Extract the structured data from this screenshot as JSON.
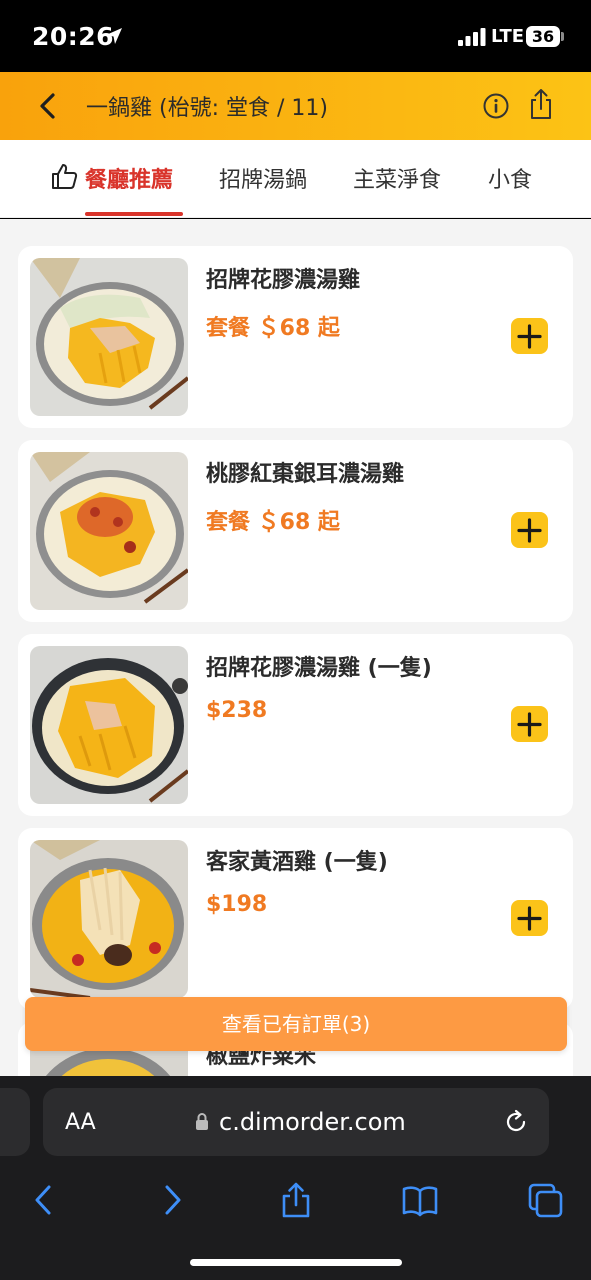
{
  "status_bar": {
    "time": "20:26",
    "network": "LTE",
    "battery": "36"
  },
  "header": {
    "title": "一鍋雞 (枱號: 堂食 / 11)"
  },
  "tabs": [
    {
      "label": "餐廳推薦",
      "active": true
    },
    {
      "label": "招牌湯鍋",
      "active": false
    },
    {
      "label": "主菜淨食",
      "active": false
    },
    {
      "label": "小食",
      "active": false
    }
  ],
  "menu_items": [
    {
      "name": "招牌花膠濃湯雞",
      "price": "套餐 ＄68 起"
    },
    {
      "name": "桃膠紅棗銀耳濃湯雞",
      "price": "套餐 ＄68 起"
    },
    {
      "name": "招牌花膠濃湯雞 (一隻)",
      "price": "$238"
    },
    {
      "name": "客家黃酒雞 (一隻)",
      "price": "$198"
    },
    {
      "name": "椒鹽炸粟米",
      "price": ""
    }
  ],
  "order_bar": {
    "label": "查看已有訂單(3)"
  },
  "browser": {
    "aa_label": "AA",
    "url": "c.dimorder.com"
  },
  "colors": {
    "header_start": "#f9a20c",
    "header_end": "#fcc315",
    "accent_red": "#d9342b",
    "price_orange": "#f07a22",
    "add_button": "#fbc319",
    "order_bar": "#fd9a43"
  }
}
